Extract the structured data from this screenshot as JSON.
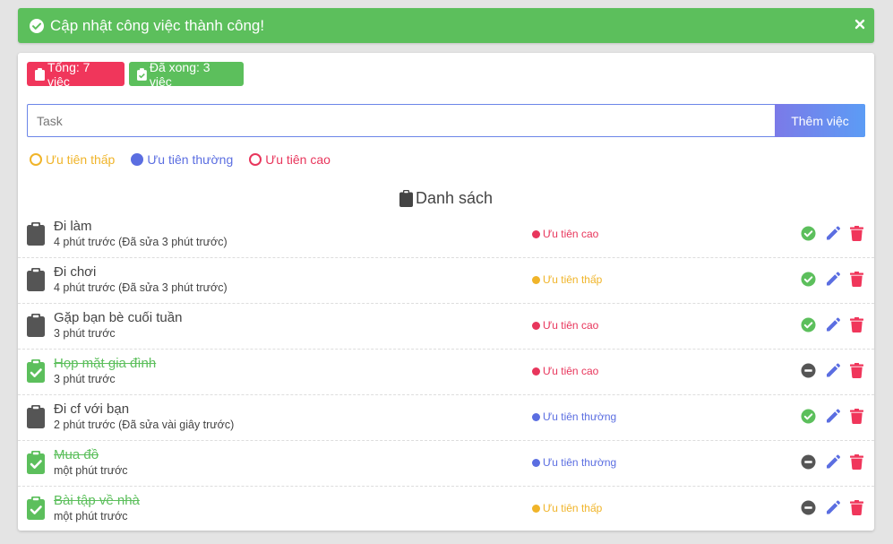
{
  "alert": {
    "message": "Cập nhật công việc thành công!",
    "color": "#5cbf5c"
  },
  "badges": {
    "total": "Tổng: 7 việc",
    "done": "Đã xong: 3 việc"
  },
  "form": {
    "placeholder": "Task",
    "value": "",
    "add_label": "Thêm việc"
  },
  "priorities": {
    "low": "Ưu tiên thấp",
    "normal": "Ưu tiên thường",
    "high": "Ưu tiên cao",
    "selected": "normal"
  },
  "list": {
    "title": "Danh sách"
  },
  "tasks": [
    {
      "name": "Đi làm",
      "time": "4 phút trước (Đã sửa 3 phút trước)",
      "priority": "high",
      "priority_label": "Ưu tiên cao",
      "done": false
    },
    {
      "name": "Đi chơi",
      "time": "4 phút trước (Đã sửa 3 phút trước)",
      "priority": "low",
      "priority_label": "Ưu tiên thấp",
      "done": false
    },
    {
      "name": "Gặp bạn bè cuối tuần",
      "time": "3 phút trước",
      "priority": "high",
      "priority_label": "Ưu tiên cao",
      "done": false
    },
    {
      "name": "Họp mặt gia đình",
      "time": "3 phút trước",
      "priority": "high",
      "priority_label": "Ưu tiên cao",
      "done": true
    },
    {
      "name": "Đi cf với bạn",
      "time": "2 phút trước (Đã sửa vài giây trước)",
      "priority": "normal",
      "priority_label": "Ưu tiên thường",
      "done": false
    },
    {
      "name": "Mua đồ",
      "time": "một phút trước",
      "priority": "normal",
      "priority_label": "Ưu tiên thường",
      "done": true
    },
    {
      "name": "Bài tập về nhà",
      "time": "một phút trước",
      "priority": "low",
      "priority_label": "Ưu tiên thấp",
      "done": true
    }
  ],
  "colors": {
    "success": "#5cbf5c",
    "danger": "#f0365b",
    "primary": "#5b6ee1",
    "warning": "#f0b429",
    "muted": "#555555"
  },
  "icons": {
    "done_action": "check-circle-icon",
    "undo_action": "minus-circle-icon",
    "edit": "pencil-icon",
    "delete": "trash-icon",
    "task": "clipboard-icon",
    "task_done": "clipboard-check-icon"
  }
}
